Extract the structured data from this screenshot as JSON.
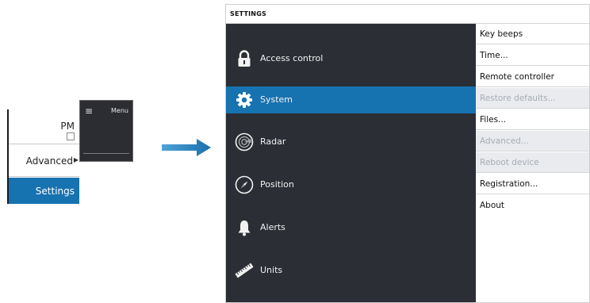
{
  "mini_menu": {
    "pm_label": "PM",
    "advanced_label": "Advanced",
    "settings_label": "Settings",
    "menu_label": "Menu"
  },
  "settings": {
    "title": "SETTINGS",
    "categories": [
      {
        "label": "Access control",
        "icon": "padlock-icon",
        "active": false
      },
      {
        "label": "System",
        "icon": "gear-icon",
        "active": true
      },
      {
        "label": "Radar",
        "icon": "radar-icon",
        "active": false
      },
      {
        "label": "Position",
        "icon": "compass-icon",
        "active": false
      },
      {
        "label": "Alerts",
        "icon": "bell-icon",
        "active": false
      },
      {
        "label": "Units",
        "icon": "ruler-icon",
        "active": false
      }
    ],
    "options": [
      {
        "label": "Key beeps",
        "enabled": true
      },
      {
        "label": "Time...",
        "enabled": true
      },
      {
        "label": "Remote controller",
        "enabled": true
      },
      {
        "label": "Restore defaults...",
        "enabled": false
      },
      {
        "label": "Files...",
        "enabled": true
      },
      {
        "label": "Advanced...",
        "enabled": false
      },
      {
        "label": "Reboot device",
        "enabled": false
      },
      {
        "label": "Registration...",
        "enabled": true
      },
      {
        "label": "About",
        "enabled": true
      }
    ]
  },
  "colors": {
    "accent": "#1772b0",
    "panel_dark": "#2b2e34",
    "disabled_bg": "#e9ebef",
    "disabled_text": "#a7adb4"
  }
}
